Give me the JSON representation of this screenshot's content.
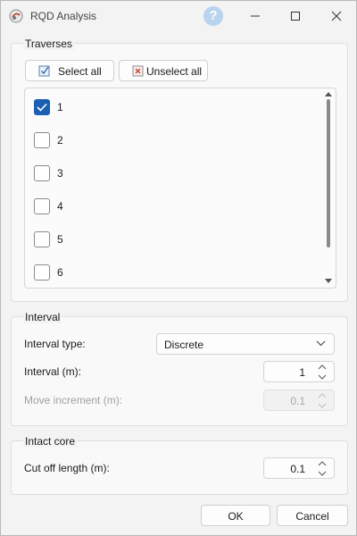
{
  "window": {
    "title": "RQD Analysis",
    "help_label": "?"
  },
  "traverses": {
    "group_title": "Traverses",
    "select_all_label": "Select all",
    "unselect_all_label": "Unselect all",
    "items": [
      {
        "label": "1",
        "checked": true
      },
      {
        "label": "2",
        "checked": false
      },
      {
        "label": "3",
        "checked": false
      },
      {
        "label": "4",
        "checked": false
      },
      {
        "label": "5",
        "checked": false
      },
      {
        "label": "6",
        "checked": false
      }
    ]
  },
  "interval": {
    "group_title": "Interval",
    "type_label": "Interval type:",
    "type_value": "Discrete",
    "interval_label": "Interval (m):",
    "interval_value": "1",
    "move_increment_label": "Move increment (m):",
    "move_increment_value": "0.1"
  },
  "intact_core": {
    "group_title": "Intact core",
    "cutoff_label": "Cut off length (m):",
    "cutoff_value": "0.1"
  },
  "footer": {
    "ok_label": "OK",
    "cancel_label": "Cancel"
  },
  "colors": {
    "accent": "#1b5fb3",
    "help_icon": "#b8d4ee"
  }
}
